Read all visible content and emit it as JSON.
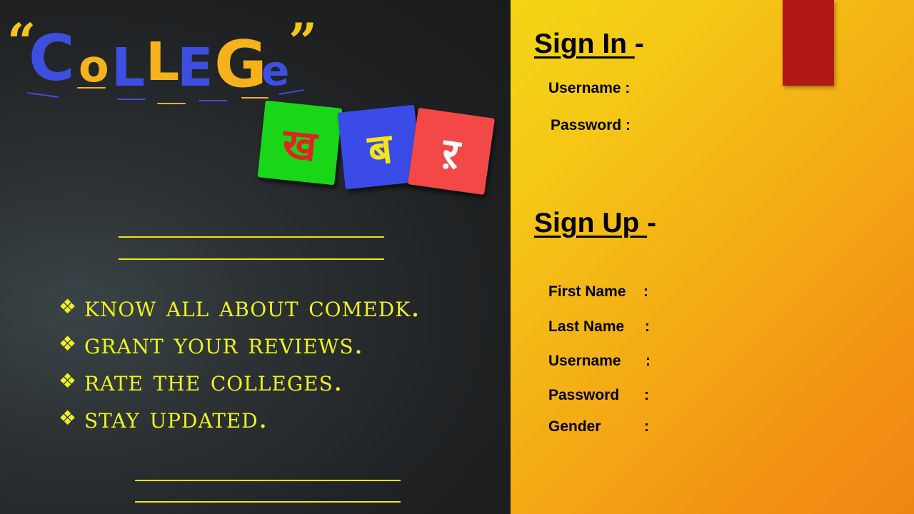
{
  "logo": {
    "open_quote": "“",
    "close_quote": "”",
    "letters": [
      "C",
      "o",
      "L",
      "L",
      "E",
      "G",
      "e"
    ],
    "letter_colors": [
      "#3d4fe0",
      "#f5b21a",
      "#3d4fe0",
      "#f5b21a",
      "#3d4fe0",
      "#f5b21a",
      "#3d4fe0"
    ],
    "hindi_tiles": [
      {
        "char": "ख",
        "bg": "#19d619",
        "fg": "#e22222"
      },
      {
        "char": "ब",
        "bg": "#3a4be8",
        "fg": "#f5e418"
      },
      {
        "char": "ऱ",
        "bg": "#f24848",
        "fg": "#ffffff"
      }
    ]
  },
  "features": [
    {
      "bullet": "❖",
      "text": "Know all about ComedK."
    },
    {
      "bullet": "❖",
      "text": "Grant your reviews."
    },
    {
      "bullet": "❖",
      "text": "Rate the colleges."
    },
    {
      "bullet": "❖",
      "text": "Stay updated."
    }
  ],
  "sign_in": {
    "heading": "Sign In ",
    "dash": "-",
    "fields": [
      {
        "label": "Username :"
      },
      {
        "label": "Password :"
      }
    ]
  },
  "sign_up": {
    "heading": "Sign Up ",
    "dash": "-",
    "fields": [
      {
        "label": "First Name",
        "colon": ":"
      },
      {
        "label": "Last Name",
        "colon": ":"
      },
      {
        "label": "Username",
        "colon": ":"
      },
      {
        "label": "Password",
        "colon": ":"
      },
      {
        "label": "Gender",
        "colon": ":"
      }
    ]
  },
  "colors": {
    "left_bg": "#1e2022",
    "feature_text": "#eff21e",
    "bookmark": "#b01717"
  }
}
